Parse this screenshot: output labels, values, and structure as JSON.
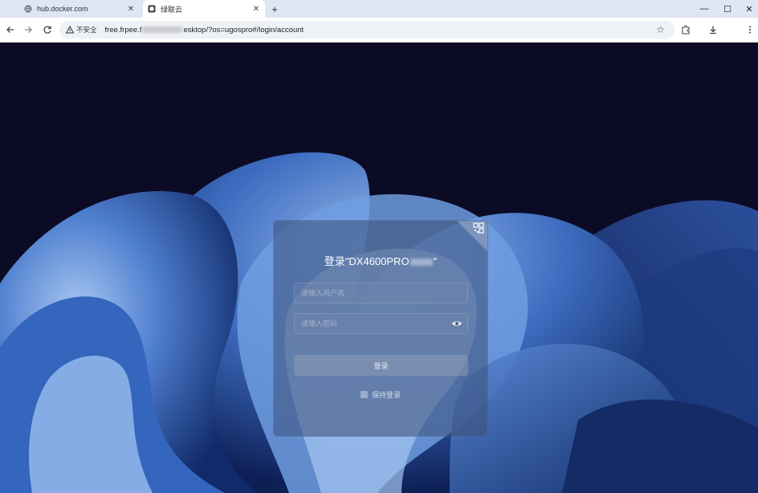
{
  "browser": {
    "tabs": [
      {
        "title": "hub.docker.com",
        "active": false
      },
      {
        "title": "绿联云",
        "active": true
      }
    ],
    "new_tab": "+",
    "window_controls": {
      "minimize": "—",
      "maximize": "☐",
      "close": "✕"
    },
    "security_label": "不安全",
    "url_prefix": "free.frpee.f",
    "url_suffix": "esktop/?os=ugospro#/login/account"
  },
  "login": {
    "title_prefix": "登录\"DX4600PRO",
    "title_suffix": "\"",
    "username_placeholder": "请输入用户名",
    "password_placeholder": "请输入密码",
    "submit_label": "登录",
    "remember_label": "保持登录"
  },
  "colors": {
    "background": "#0d0c26",
    "card": "#3c5078",
    "accent_blue": "#4f7fd0"
  }
}
